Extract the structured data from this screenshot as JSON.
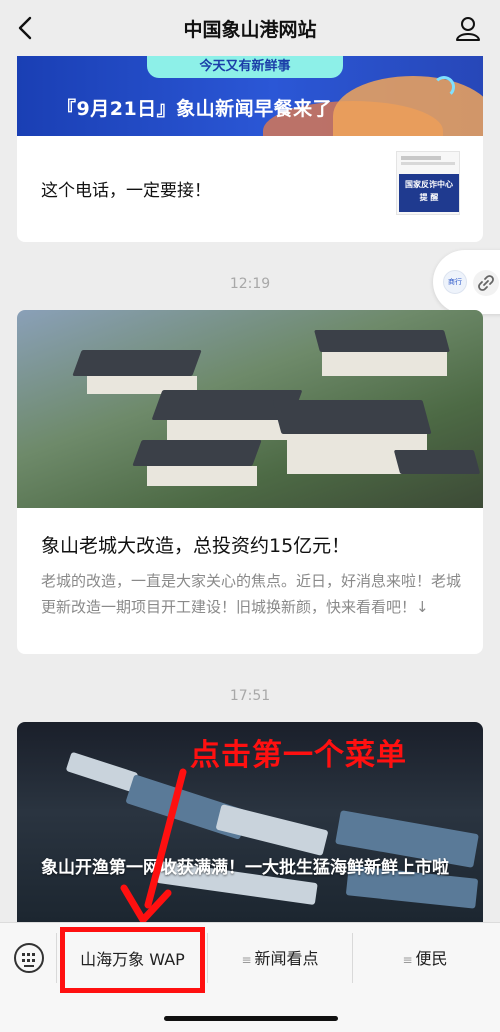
{
  "nav": {
    "title": "中国象山港网站",
    "back_icon": "chevron-left-icon",
    "user_icon": "user-icon"
  },
  "card1": {
    "banner_pill": "今天又有新鲜事",
    "banner_text": "『9月21日』象山新闻早餐来了",
    "title": "这个电话，一定要接！",
    "thumb_text": "国家反诈中心\n提 醒"
  },
  "time1": "12:19",
  "float_link": {
    "label": "商行",
    "icon": "link-icon"
  },
  "card2": {
    "title": "象山老城大改造，总投资约15亿元！",
    "desc": "老城的改造，一直是大家关心的焦点。近日，好消息来啦！老城更新改造一期项目开工建设！旧城换新颜，快来看看吧！↓"
  },
  "time2": "17:51",
  "card3": {
    "title": "象山开渔第一网收获满满！一大批生猛海鲜新鲜上市啦"
  },
  "annotation": {
    "text": "点击第一个菜单",
    "color": "#ff1010"
  },
  "menu": {
    "keyboard_icon": "keyboard-icon",
    "items": [
      {
        "label": "山海万象 WAP",
        "prefix": ""
      },
      {
        "label": "新闻看点",
        "prefix": "≡"
      },
      {
        "label": "便民",
        "prefix": "≡"
      }
    ]
  }
}
